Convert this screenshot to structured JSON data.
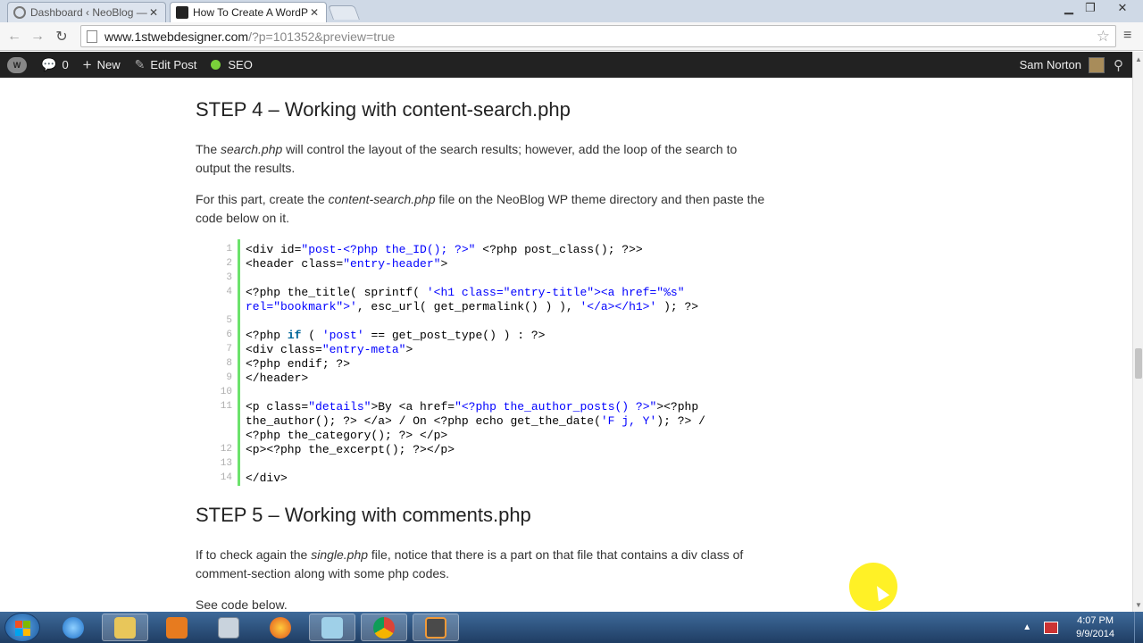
{
  "browser": {
    "tabs": [
      {
        "label": "Dashboard ‹ NeoBlog — W",
        "state": "inactive"
      },
      {
        "label": "How To Create A WordPre",
        "state": "active"
      }
    ],
    "url_host": "www.1stwebdesigner.com",
    "url_path": "/?p=101352&preview=true"
  },
  "adminbar": {
    "comments_count": "0",
    "new_label": "New",
    "edit_post_label": "Edit Post",
    "seo_label": "SEO",
    "user_name": "Sam Norton",
    "seo_status_color": "#7ad03a"
  },
  "article": {
    "step4_heading": "STEP 4 – Working with content-search.php",
    "p1_a": "The ",
    "p1_em": "search.php",
    "p1_b": " will control the layout of the search results; however, add the loop of the search to output the results.",
    "p2_a": "For this part, create the ",
    "p2_em": "content-search.php",
    "p2_b": " file on the NeoBlog WP theme directory and then paste the code below on it.",
    "step5_heading": "STEP 5 – Working with comments.php",
    "p3_a": "If to check again the ",
    "p3_em": "single.php",
    "p3_b": " file, notice that there is a part on that file that contains a div class of comment-section along with some php codes.",
    "p4": "See code below."
  },
  "code": {
    "line_numbers": [
      "1",
      "2",
      "3",
      "4",
      "5",
      "6",
      "7",
      "8",
      "9",
      "10",
      "11",
      "12",
      "13",
      "14"
    ],
    "l1a": "<div id=",
    "l1s": "\"post-<?php the_ID(); ?>\"",
    "l1b": " <?php post_class(); ?>>",
    "l2a": "<header class=",
    "l2s": "\"entry-header\"",
    "l2b": ">",
    "l4a": "<?php the_title( sprintf( ",
    "l4s": "'<h1 class=\"entry-title\"><a href=\"%s\"",
    "l4b": "rel=\"bookmark\">'",
    "l4c": ", esc_url( get_permalink() ) ), ",
    "l4d": "'</a></h1>'",
    "l4e": " ); ?>",
    "l6a": "<?php ",
    "l6k": "if",
    "l6b": " ( ",
    "l6s": "'post'",
    "l6c": " == get_post_type() ) : ?>",
    "l7a": "<div class=",
    "l7s": "\"entry-meta\"",
    "l7b": ">",
    "l8": "<?php endif; ?>",
    "l9": "</header>",
    "l11a": "<p class=",
    "l11s": "\"details\"",
    "l11b": ">By <a href=",
    "l11c": "\"<?php the_author_posts() ?>\"",
    "l11d": "><?php",
    "l11e": "the_author(); ?> </a> / On <?php echo get_the_date(",
    "l11f": "'F j, Y'",
    "l11g": "); ?> /",
    "l11h": "<?php the_category(); ?> </p>",
    "l12": "<p><?php the_excerpt(); ?></p>",
    "l14": "</div>"
  },
  "taskbar": {
    "clock_time": "4:07 PM",
    "clock_date": "9/9/2014"
  },
  "colors": {
    "gutter_border": "#6ce26c",
    "string": "#0000ff",
    "keyword": "#006699",
    "adminbar_bg": "#222222"
  }
}
